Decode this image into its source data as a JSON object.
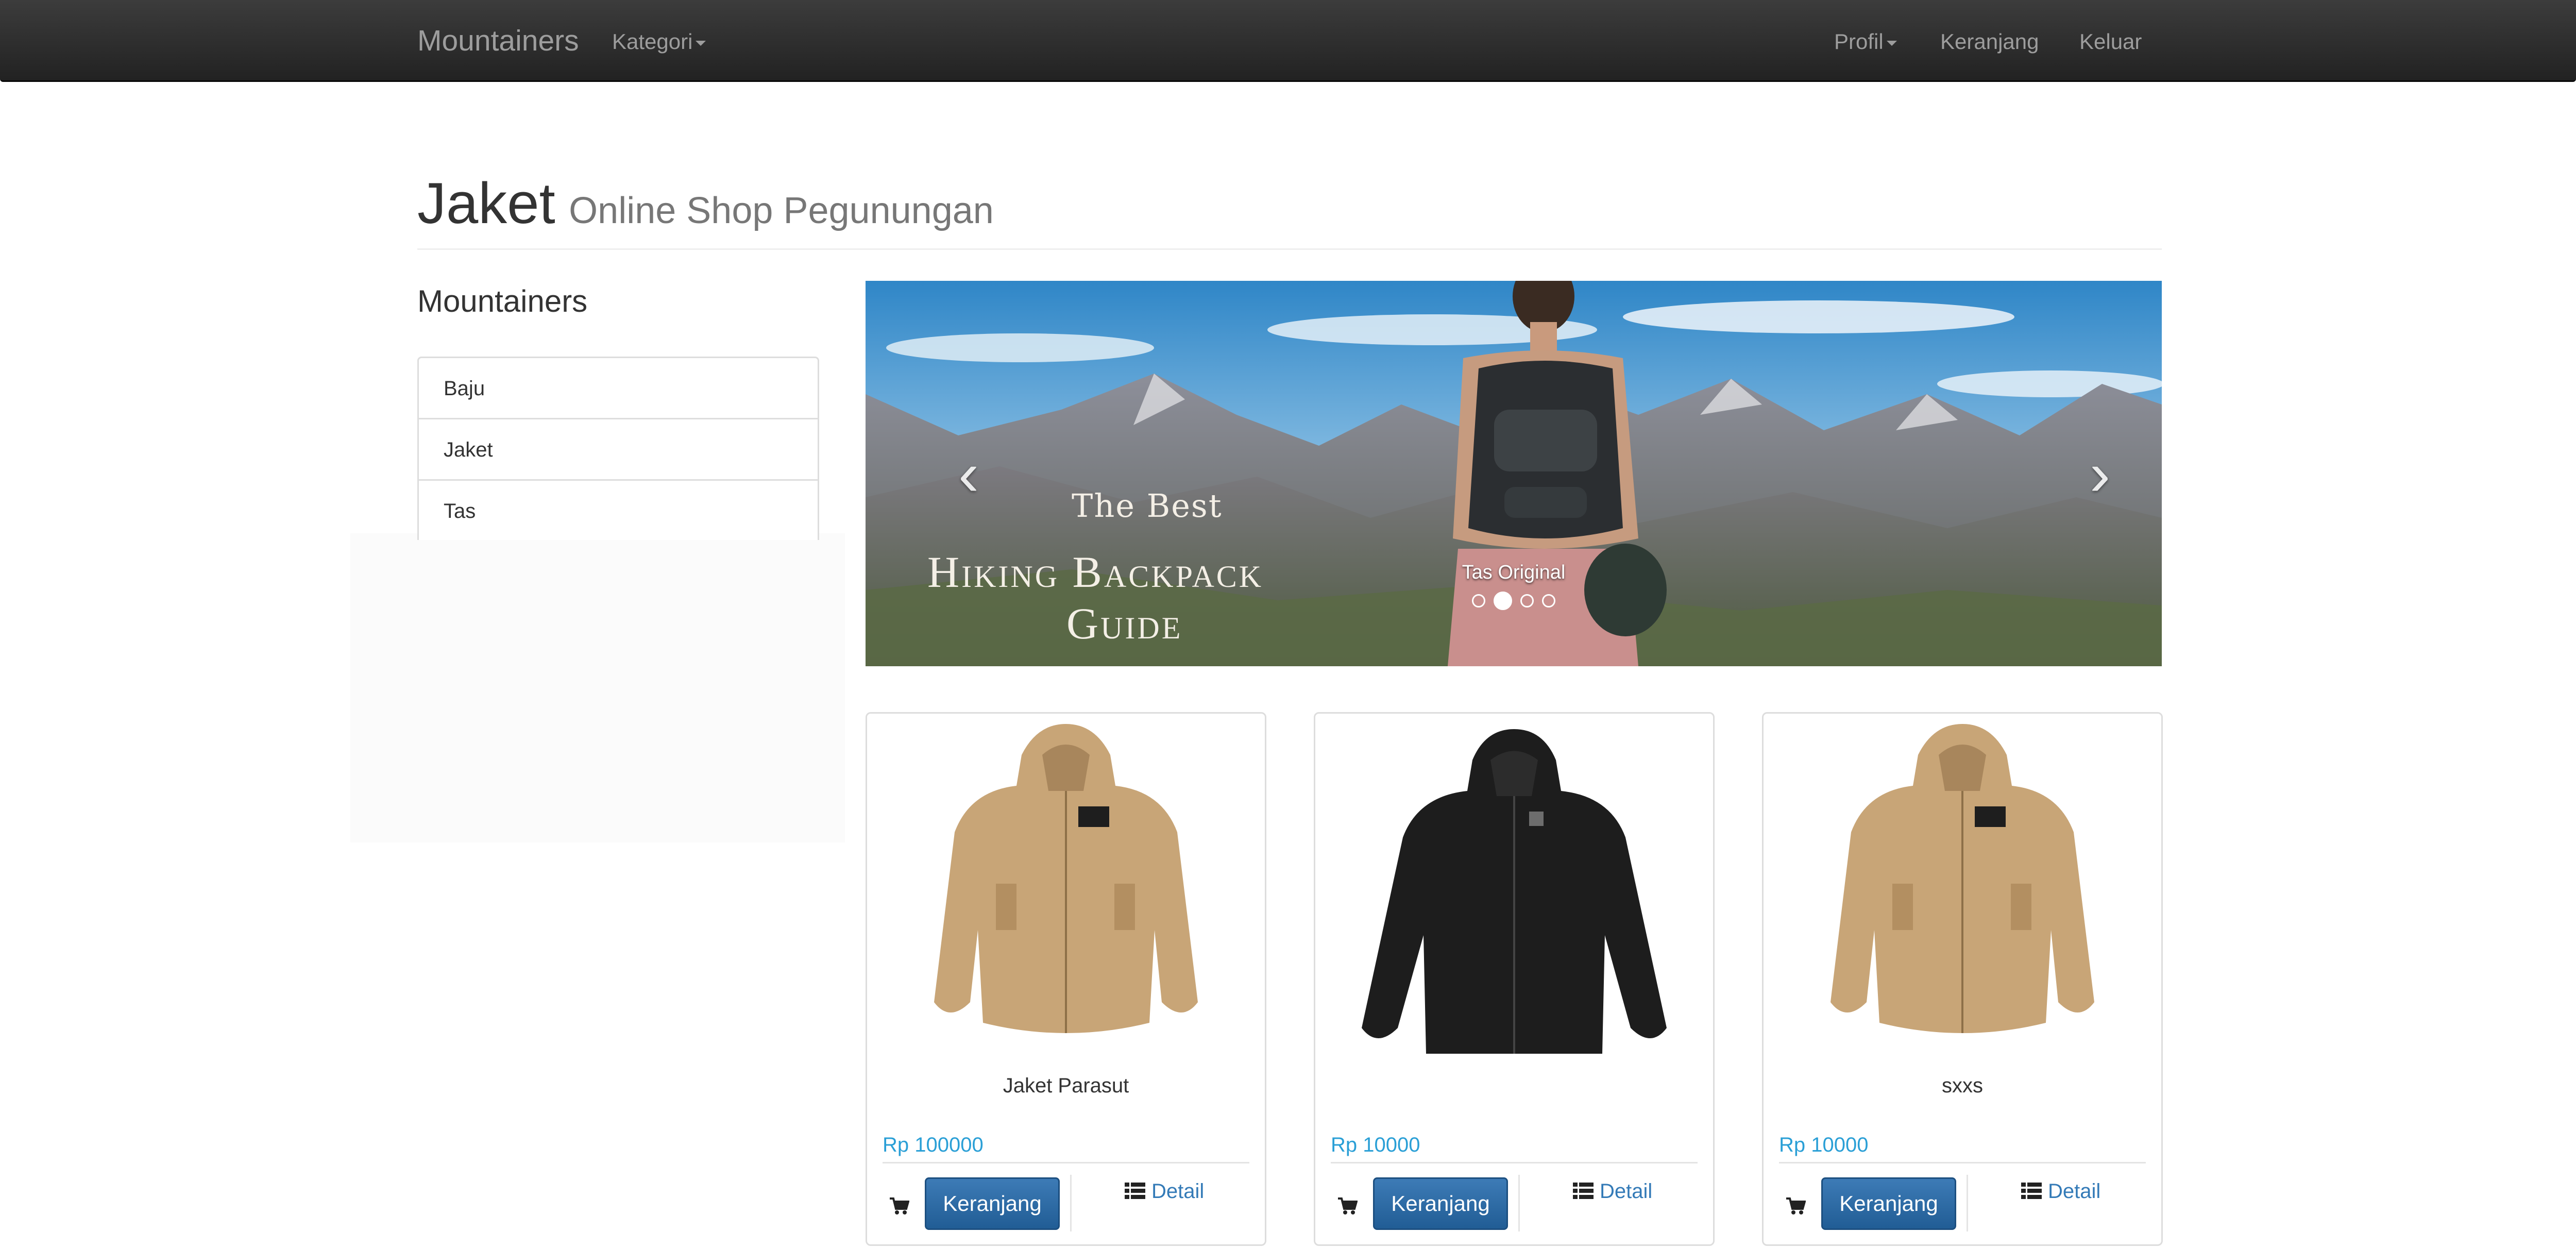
{
  "navbar": {
    "brand": "Mountainers",
    "kategori": "Kategori",
    "profil": "Profil",
    "keranjang": "Keranjang",
    "keluar": "Keluar"
  },
  "header": {
    "title": "Jaket",
    "subtitle": "Online Shop Pegunungan"
  },
  "sidebar": {
    "title": "Mountainers",
    "items": [
      {
        "label": "Baju"
      },
      {
        "label": "Jaket"
      },
      {
        "label": "Tas"
      }
    ]
  },
  "carousel": {
    "caption": "Tas Original",
    "banner_lines": [
      "The Best",
      "Hiking Backpack",
      "Guide"
    ],
    "prev_icon": "chevron-left-icon",
    "next_icon": "chevron-right-icon",
    "slide_count": 4,
    "active_index": 1
  },
  "products": [
    {
      "name": "Jaket Parasut",
      "price": "Rp 100000",
      "image": "tan-jacket",
      "cart_label": "Keranjang",
      "detail_label": "Detail"
    },
    {
      "name": "",
      "price": "Rp 10000",
      "image": "black-jacket",
      "cart_label": "Keranjang",
      "detail_label": "Detail"
    },
    {
      "name": "sxxs",
      "price": "Rp 10000",
      "image": "tan-jacket",
      "cart_label": "Keranjang",
      "detail_label": "Detail"
    }
  ],
  "colors": {
    "navbar": "#222222",
    "price": "#2a9fd6",
    "button": "#286090",
    "link": "#337ab7"
  }
}
